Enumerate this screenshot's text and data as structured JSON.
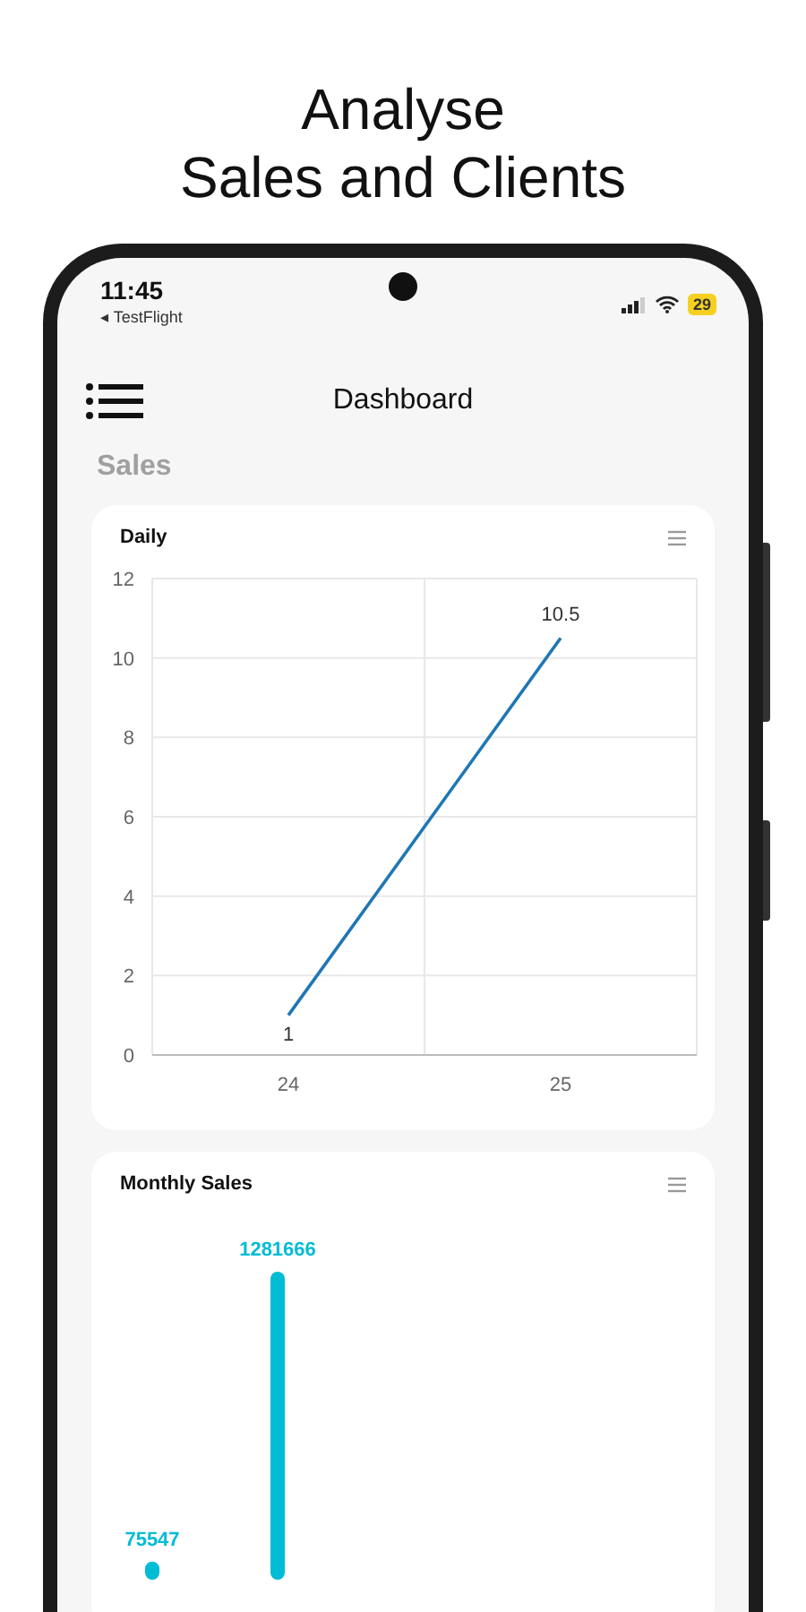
{
  "headline": [
    "Analyse",
    "Sales and Clients"
  ],
  "status_bar": {
    "time": "11:45",
    "back_app": "◂ TestFlight",
    "battery": "29"
  },
  "header": {
    "title": "Dashboard"
  },
  "section": "Sales",
  "cards": [
    {
      "title": "Daily",
      "chart_data": {
        "type": "line",
        "categories": [
          "24",
          "25"
        ],
        "series": [
          {
            "color": "#1f77b4",
            "values": [
              1,
              10.5
            ]
          }
        ],
        "ylim": [
          0,
          12
        ],
        "yticks": [
          0,
          2,
          4,
          6,
          8,
          10,
          12
        ],
        "grid": true,
        "data_labels": true
      }
    },
    {
      "title": "Monthly Sales",
      "chart_data": {
        "type": "bar",
        "categories": [
          null,
          null
        ],
        "series": [
          {
            "color": "#00bcd4",
            "values": [
              75547,
              1281666
            ]
          }
        ],
        "data_labels": true
      }
    }
  ]
}
